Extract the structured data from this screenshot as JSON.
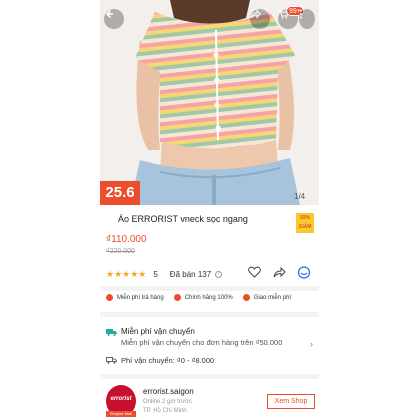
{
  "colors": {
    "accent": "#ee4d2d",
    "star": "#f5a623",
    "badge_yellow": "#f6c92d"
  },
  "header": {
    "back_icon": "back-arrow-icon",
    "share_icon": "share-icon",
    "cart_icon": "cart-icon",
    "cart_count": "99+",
    "more_icon": "more-vertical-icon"
  },
  "image": {
    "sale_tag": "25.6",
    "page_counter": "1/4"
  },
  "product": {
    "title": "Áo ERRORIST vneck sọc ngang",
    "badge": "50% GIẢM",
    "price": "₫110.000",
    "old_price": "₫220.000",
    "rating": "5",
    "sold": "Đã bán 137"
  },
  "perks": [
    {
      "label": "Miễn phí trả hàng"
    },
    {
      "label": "Chính hãng 100%"
    },
    {
      "label": "Giao miễn phí"
    }
  ],
  "shipping": {
    "title": "Miễn phí vận chuyển",
    "desc": "Miễn phí vận chuyển cho đơn hàng trên ₫50.000",
    "fee": "Phí vận chuyển: ₫0 - ₫8.000"
  },
  "shop": {
    "logo_text": "errorist",
    "mall_label": "Shopee Mall",
    "name": "errorist.saigon",
    "online": "Online 2 giờ trước",
    "location": "TP. Hồ Chí Minh",
    "view_button": "Xem Shop"
  }
}
